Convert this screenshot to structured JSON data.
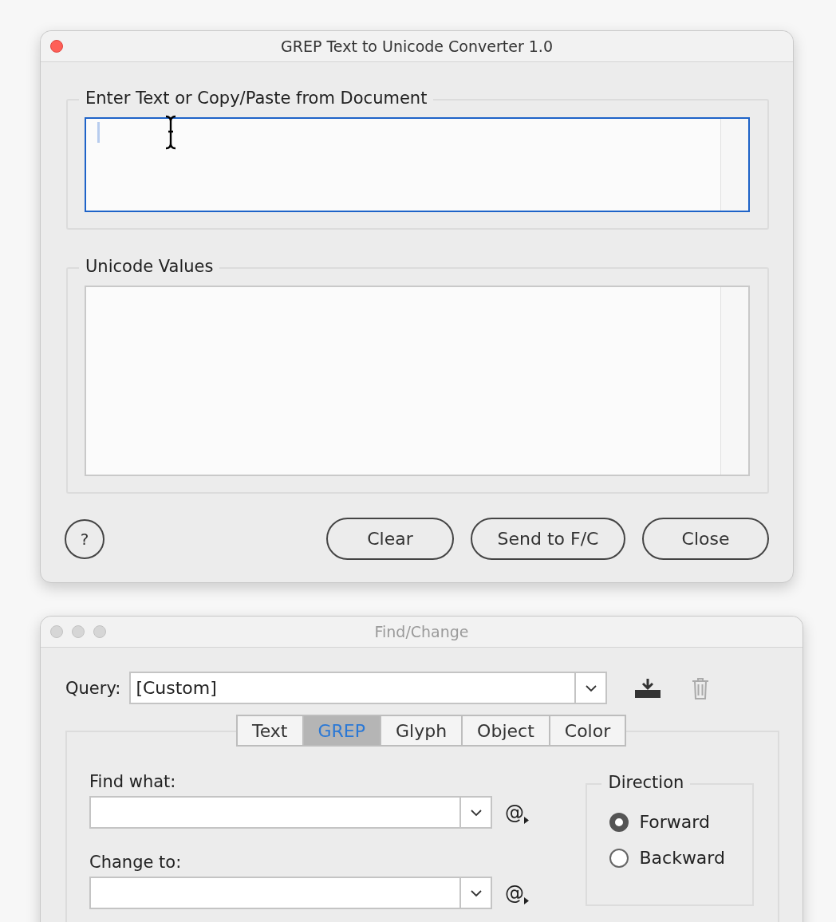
{
  "converter": {
    "title": "GREP Text to Unicode Converter 1.0",
    "input_group": {
      "label": "Enter Text or Copy/Paste from Document"
    },
    "output_group": {
      "label": "Unicode Values"
    },
    "help": "?",
    "buttons": [
      "Clear",
      "Send to F/C",
      "Close"
    ]
  },
  "find_change": {
    "title": "Find/Change",
    "query": {
      "label": "Query:",
      "value": "[Custom]"
    },
    "tabs": [
      {
        "label": "Text",
        "selected": false
      },
      {
        "label": "GREP",
        "selected": true
      },
      {
        "label": "Glyph",
        "selected": false
      },
      {
        "label": "Object",
        "selected": false
      },
      {
        "label": "Color",
        "selected": false
      }
    ],
    "fields": [
      {
        "label": "Find what:",
        "special": "@"
      },
      {
        "label": "Change to:",
        "special": "@"
      }
    ],
    "direction": {
      "label": "Direction",
      "options": [
        {
          "label": "Forward",
          "selected": true
        },
        {
          "label": "Backward",
          "selected": false
        }
      ]
    }
  }
}
